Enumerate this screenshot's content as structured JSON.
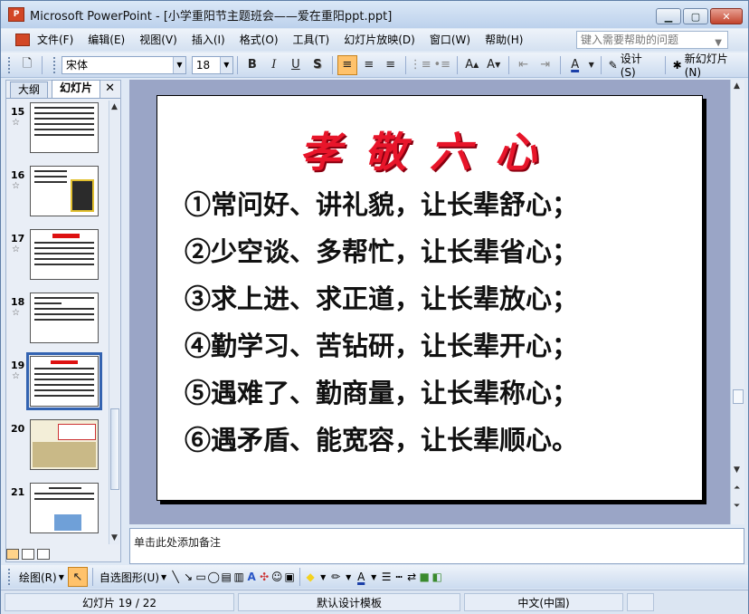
{
  "window": {
    "app_icon_text": "P",
    "title": "Microsoft PowerPoint - [小学重阳节主题班会——爱在重阳ppt.ppt]",
    "minimize": "▁",
    "maximize": "▢",
    "close": "✕"
  },
  "menu": {
    "items": [
      "文件(F)",
      "编辑(E)",
      "视图(V)",
      "插入(I)",
      "格式(O)",
      "工具(T)",
      "幻灯片放映(D)",
      "窗口(W)",
      "帮助(H)"
    ],
    "help_placeholder": "键入需要帮助的问题"
  },
  "toolbar": {
    "font": "宋体",
    "size": "18",
    "bold": "B",
    "italic": "I",
    "underline": "U",
    "shadow": "S",
    "design_label": "设计(S)",
    "new_slide_label": "新幻灯片(N)"
  },
  "left_pane": {
    "tab_outline": "大纲",
    "tab_slides": "幻灯片",
    "close": "✕",
    "slides": [
      {
        "num": "15",
        "star": "☆"
      },
      {
        "num": "16",
        "star": "☆"
      },
      {
        "num": "17",
        "star": "☆"
      },
      {
        "num": "18",
        "star": "☆"
      },
      {
        "num": "19",
        "star": "☆"
      },
      {
        "num": "20",
        "star": ""
      },
      {
        "num": "21",
        "star": ""
      }
    ]
  },
  "slide": {
    "title": "孝敬六心",
    "lines": [
      "①常问好、讲礼貌，让长辈舒心；",
      "②少空谈、多帮忙，让长辈省心；",
      "③求上进、求正道，让长辈放心；",
      "④勤学习、苦钻研，让长辈开心；",
      "⑤遇难了、勤商量，让长辈称心；",
      "⑥遇矛盾、能宽容，让长辈顺心。"
    ]
  },
  "notes": {
    "placeholder": "单击此处添加备注"
  },
  "drawbar": {
    "draw_label": "绘图(R)",
    "autoshapes_label": "自选图形(U)"
  },
  "status": {
    "slide_info": "幻灯片 19 / 22",
    "template": "默认设计模板",
    "language": "中文(中国)"
  }
}
